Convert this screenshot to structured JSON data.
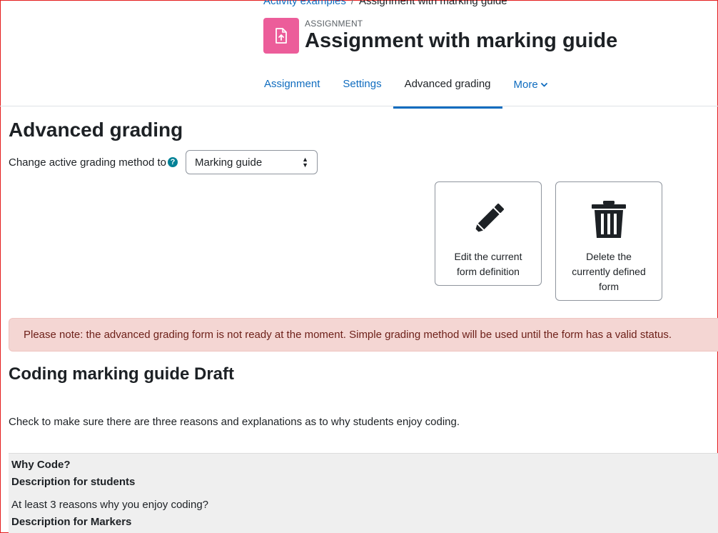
{
  "breadcrumb": {
    "parent": "Activity examples",
    "separator": "/",
    "current": "Assignment with marking guide"
  },
  "activity": {
    "type_label": "ASSIGNMENT",
    "title": "Assignment with marking guide",
    "icon": "assignment-upload-icon",
    "icon_color": "#ec5d9a"
  },
  "nav": {
    "tabs": [
      {
        "label": "Assignment"
      },
      {
        "label": "Settings"
      },
      {
        "label": "Advanced grading",
        "active": true
      },
      {
        "label": "More"
      }
    ]
  },
  "page": {
    "heading": "Advanced grading",
    "method_label": "Change active grading method to",
    "method_selected": "Marking guide"
  },
  "actions": {
    "edit_label": "Edit the current form definition",
    "delete_label": "Delete the currently defined form"
  },
  "alert": {
    "text": "Please note: the advanced grading form is not ready at the moment. Simple grading method will be used until the form has a valid status."
  },
  "guide": {
    "title": "Coding marking guide Draft",
    "description": "Check to make sure there are three reasons and explanations as to why students enjoy coding.",
    "criterion": {
      "name": "Why Code?",
      "students_heading": "Description for students",
      "students_text": "At least 3 reasons why you enjoy coding?",
      "markers_heading": "Description for Markers"
    }
  },
  "colors": {
    "link": "#0f6cbf",
    "alert_bg": "#f4d6d3",
    "alert_text": "#6e211a",
    "help_icon": "#008196"
  }
}
